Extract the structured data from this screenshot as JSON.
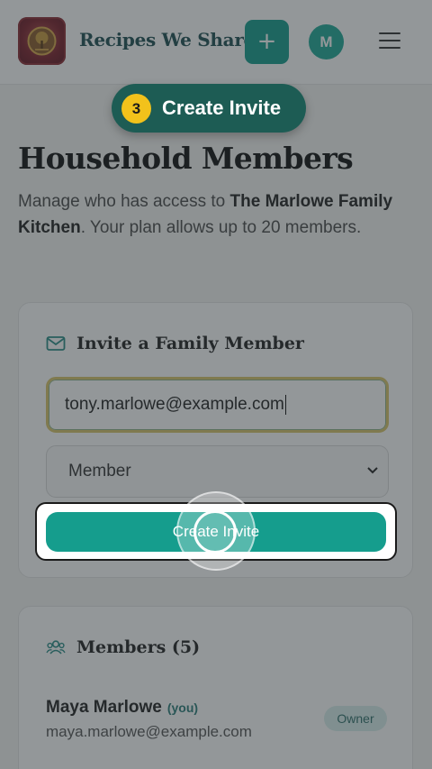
{
  "header": {
    "brand": "Recipes We Share",
    "add_label": "+",
    "avatar_initial": "M"
  },
  "page": {
    "title": "Household Members",
    "desc_prefix": "Manage who has access to ",
    "household_name": "The Marlowe Family Kitchen",
    "desc_suffix": ". Your plan allows up to 20 members."
  },
  "invite": {
    "title": "Invite a Family Member",
    "email_value": "tony.marlowe@example.com",
    "role_selected": "Member",
    "submit_label": "Create Invite"
  },
  "members": {
    "title": "Members (5)",
    "items": [
      {
        "name": "Maya Marlowe",
        "you_tag": "(you)",
        "email": "maya.marlowe@example.com",
        "role": "Owner"
      }
    ]
  },
  "tutorial": {
    "step_number": "3",
    "step_label": "Create Invite"
  },
  "colors": {
    "accent": "#159d8d",
    "brand_text": "#1f4f52",
    "step_badge": "#f2c21b",
    "step_pill": "#1d5c54"
  },
  "icons": {
    "logo": "tree-emblem-icon",
    "invite": "mail-icon",
    "members": "users-icon",
    "menu": "hamburger-icon",
    "select": "chevron-down-icon"
  }
}
